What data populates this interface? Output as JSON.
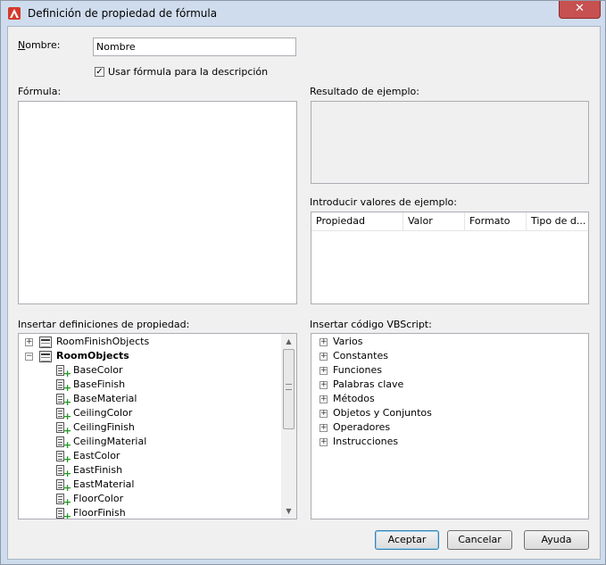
{
  "window": {
    "title": "Definición de propiedad de fórmula",
    "close_glyph": "✕"
  },
  "name_field": {
    "label": "Nombre:",
    "value": "Nombre"
  },
  "use_formula_checkbox": {
    "label": "Usar fórmula para la descripción",
    "checked": true
  },
  "formula": {
    "label": "Fórmula:",
    "value": ""
  },
  "sample_result": {
    "label": "Resultado de ejemplo:",
    "value": ""
  },
  "sample_values": {
    "label": "Introducir valores de ejemplo:",
    "columns": [
      "Propiedad",
      "Valor",
      "Formato",
      "Tipo de d..."
    ]
  },
  "property_definitions": {
    "label": "Insertar definiciones de propiedad:",
    "groups": [
      {
        "name": "RoomFinishObjects",
        "expanded": false,
        "bold": false
      },
      {
        "name": "RoomObjects",
        "expanded": true,
        "bold": true
      }
    ],
    "items": [
      "BaseColor",
      "BaseFinish",
      "BaseMaterial",
      "CeilingColor",
      "CeilingFinish",
      "CeilingMaterial",
      "EastColor",
      "EastFinish",
      "EastMaterial",
      "FloorColor",
      "FloorFinish"
    ]
  },
  "vbscript": {
    "label": "Insertar código VBScript:",
    "items": [
      "Varios",
      "Constantes",
      "Funciones",
      "Palabras clave",
      "Métodos",
      "Objetos y Conjuntos",
      "Operadores",
      "Instrucciones"
    ]
  },
  "buttons": {
    "ok": "Aceptar",
    "cancel": "Cancelar",
    "help": "Ayuda"
  },
  "colors": {
    "accent": "#3c7fb1",
    "close": "#c75050",
    "plus": "#1e9a1e",
    "app_icon": "#d33a2c"
  }
}
